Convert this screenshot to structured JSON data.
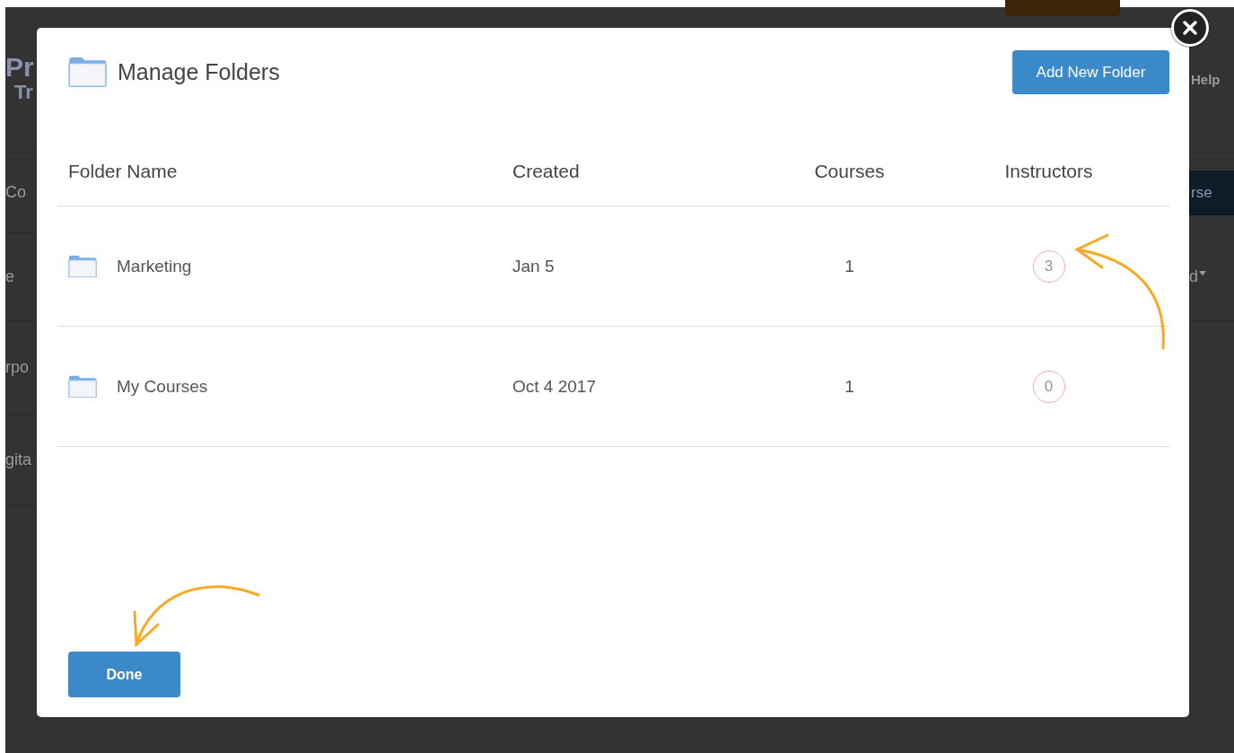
{
  "background": {
    "logo": "Pr",
    "logo_sub": "Tr",
    "help": "Help",
    "left_rows": [
      "Co",
      "e",
      "rpo",
      "gita"
    ],
    "course_button": "rse",
    "sort_label": "d"
  },
  "dialog": {
    "title": "Manage Folders",
    "add_button": "Add New Folder",
    "columns": [
      "Folder Name",
      "Created",
      "Courses",
      "Instructors"
    ],
    "rows": [
      {
        "name": "Marketing",
        "created": "Jan 5",
        "courses": "1",
        "instructors": "3"
      },
      {
        "name": "My Courses",
        "created": "Oct 4 2017",
        "courses": "1",
        "instructors": "0"
      }
    ],
    "done_button": "Done"
  }
}
